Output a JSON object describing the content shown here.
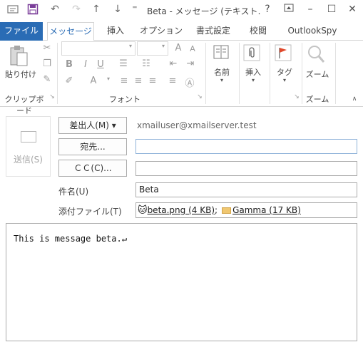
{
  "window": {
    "title": "Beta - メッセージ (テキスト…",
    "help": "?",
    "controls": [
      "restore-ribbon",
      "minimize",
      "maximize",
      "close"
    ]
  },
  "tabs": [
    {
      "label": "ファイル",
      "selected": false
    },
    {
      "label": "メッセージ",
      "selected": true
    },
    {
      "label": "挿入",
      "selected": false
    },
    {
      "label": "オプション",
      "selected": false
    },
    {
      "label": "書式設定",
      "selected": false
    },
    {
      "label": "校閲",
      "selected": false
    },
    {
      "label": "OutlookSpy",
      "selected": false
    }
  ],
  "ribbon": {
    "clipboard": {
      "paste_label": "貼り付け",
      "group_label": "クリップボード"
    },
    "font": {
      "group_label": "フォント"
    },
    "names": {
      "label": "名前"
    },
    "insert": {
      "label": "挿入"
    },
    "tags": {
      "label": "タグ"
    },
    "zoom": {
      "label": "ズーム",
      "group_label": "ズーム"
    }
  },
  "compose": {
    "send_label": "送信(S)",
    "from_button": "差出人(M)",
    "from_value": "xmailuser@xmailserver.test",
    "to_button": "宛先...",
    "to_value": "",
    "cc_button": "ＣＣ(C)...",
    "cc_value": "",
    "subject_label": "件名(U)",
    "subject_value": "Beta",
    "attach_label": "添付ファイル(T)",
    "attachments": [
      {
        "name": "beta.png (4 KB)",
        "icon": "cat-icon"
      },
      {
        "name": "Gamma (17 KB)",
        "icon": "envelope-icon"
      }
    ],
    "attach_sep": ";",
    "body": "This is message beta.↵"
  }
}
